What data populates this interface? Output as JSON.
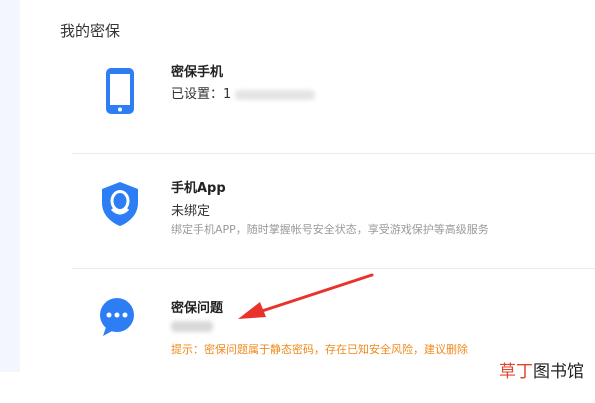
{
  "section_title": "我的密保",
  "items": [
    {
      "icon": "phone-icon",
      "title": "密保手机",
      "status": "已设置：1"
    },
    {
      "icon": "shield-penguin-icon",
      "title": "手机App",
      "status": "未绑定",
      "description": "绑定手机APP，随时掌握帐号安全状态，享受游戏保护等高级服务"
    },
    {
      "icon": "chat-bubble-icon",
      "title": "密保问题",
      "status": "",
      "warning": "提示：密保问题属于静态密码，存在已知安全风险，建议删除"
    }
  ],
  "watermark": {
    "accent": "草丁",
    "rest": "图书馆"
  },
  "colors": {
    "icon_blue": "#2d7ef5",
    "warning_orange": "#f08a1c",
    "arrow_red": "#e8322b"
  }
}
